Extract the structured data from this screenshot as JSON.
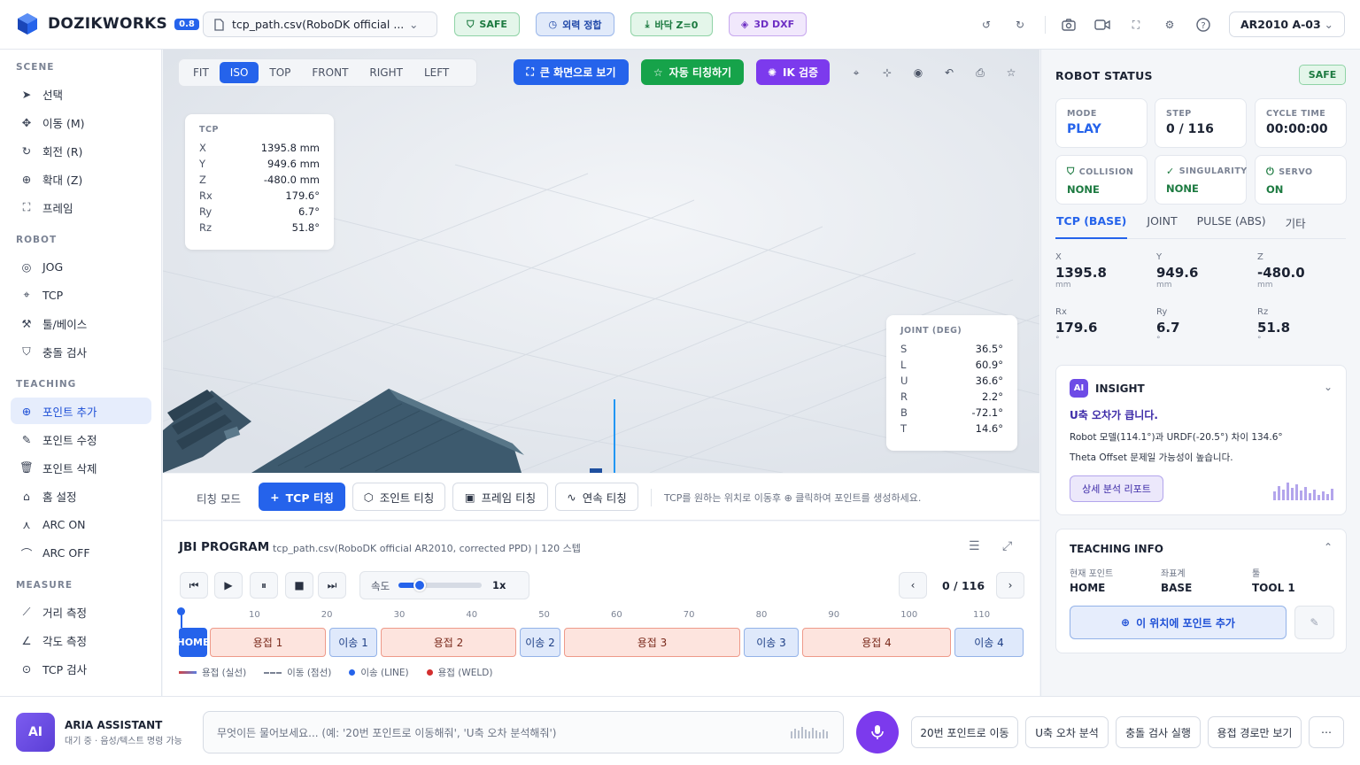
{
  "app": {
    "name": "DOZIKWORKS",
    "version": "0.8"
  },
  "header": {
    "file": "tcp_path.csv(RoboDK official ...",
    "chips": {
      "safe": "SAFE",
      "calib": "외력 정합",
      "floor": "바닥 Z=0",
      "dxf": "3D DXF"
    },
    "robot": "AR2010 A-03"
  },
  "sidebar": {
    "sections": {
      "scene": "SCENE",
      "robot": "ROBOT",
      "teaching": "TEACHING",
      "measure": "MEASURE"
    },
    "scene": [
      "선택",
      "이동 (M)",
      "회전 (R)",
      "확대 (Z)",
      "프레임"
    ],
    "robot": [
      "JOG",
      "TCP",
      "툴/베이스",
      "충돌 검사"
    ],
    "teaching": [
      "포인트 추가",
      "포인트 수정",
      "포인트 삭제",
      "홈 설정",
      "ARC ON",
      "ARC OFF"
    ],
    "measure": [
      "거리 측정",
      "각도 측정",
      "TCP 검사"
    ]
  },
  "viewport": {
    "views": [
      "FIT",
      "ISO",
      "TOP",
      "FRONT",
      "RIGHT",
      "LEFT"
    ],
    "actions": {
      "fullscreen": "큰 화면으로 보기",
      "auto_teach": "자동 티칭하기",
      "ik": "IK 검증"
    },
    "tcp": {
      "title": "TCP",
      "rows": [
        [
          "X",
          "1395.8 mm"
        ],
        [
          "Y",
          "949.6 mm"
        ],
        [
          "Z",
          "-480.0 mm"
        ],
        [
          "Rx",
          "179.6°"
        ],
        [
          "Ry",
          "6.7°"
        ],
        [
          "Rz",
          "51.8°"
        ]
      ]
    },
    "joint": {
      "title": "JOINT (DEG)",
      "rows": [
        [
          "S",
          "36.5°"
        ],
        [
          "L",
          "60.9°"
        ],
        [
          "U",
          "36.6°"
        ],
        [
          "R",
          "2.2°"
        ],
        [
          "B",
          "-72.1°"
        ],
        [
          "T",
          "14.6°"
        ]
      ]
    }
  },
  "teach": {
    "mode_label": "티칭 모드",
    "tcp": "TCP 티칭",
    "joint": "조인트 티칭",
    "frame": "프레임 티칭",
    "cont": "연속 티칭",
    "hint": "TCP를 원하는 위치로 이동후 ⊕ 클릭하여 포인트를 생성하세요."
  },
  "jbi": {
    "title": "JBI PROGRAM",
    "desc": "tcp_path.csv(RoboDK official AR2010, corrected PPD) | 120 스텝",
    "speed_label": "속도",
    "speed_value": "1x",
    "speed_pct": 25,
    "step": "0 / 116",
    "ticks": [
      "10",
      "20",
      "30",
      "40",
      "50",
      "60",
      "70",
      "80",
      "90",
      "100",
      "110"
    ],
    "segments": [
      "HOME",
      "용접 1",
      "이송 1",
      "용접 2",
      "이송 2",
      "용접 3",
      "이송 3",
      "용접 4",
      "이송 4"
    ],
    "legend": [
      "용접 (실선)",
      "이동 (점선)",
      "이송 (LINE)",
      "용접 (WELD)"
    ]
  },
  "status": {
    "title": "ROBOT STATUS",
    "badge": "SAFE",
    "cards": [
      [
        "MODE",
        "PLAY"
      ],
      [
        "STEP",
        "0 / 116"
      ],
      [
        "CYCLE TIME",
        "00:00:00"
      ],
      [
        "COLLISION",
        "NONE"
      ],
      [
        "SINGULARITY",
        "NONE"
      ],
      [
        "SERVO",
        "ON"
      ]
    ],
    "tabs": [
      "TCP (BASE)",
      "JOINT",
      "PULSE (ABS)",
      "기타"
    ],
    "values": [
      [
        "X",
        "1395.8",
        "mm"
      ],
      [
        "Y",
        "949.6",
        "mm"
      ],
      [
        "Z",
        "-480.0",
        "mm"
      ],
      [
        "Rx",
        "179.6",
        "°"
      ],
      [
        "Ry",
        "6.7",
        "°"
      ],
      [
        "Rz",
        "51.8",
        "°"
      ]
    ]
  },
  "insight": {
    "badge": "AI",
    "title": "INSIGHT",
    "headline": "U축 오차가 큽니다.",
    "line1": "Robot 모델(114.1°)과 URDF(-20.5°) 차이 134.6°",
    "line2": "Theta Offset 문제일 가능성이 높습니다.",
    "button": "상세 분석 리포트"
  },
  "teaching_info": {
    "title": "TEACHING INFO",
    "cols": [
      [
        "현재 포인트",
        "HOME"
      ],
      [
        "좌표계",
        "BASE"
      ],
      [
        "툴",
        "TOOL 1"
      ]
    ],
    "add": "이 위치에 포인트 추가"
  },
  "assistant": {
    "badge": "AI",
    "name": "ARIA ASSISTANT",
    "status": "대기 중 · 음성/텍스트 명령 가능",
    "placeholder": "무엇이든 물어보세요... (예: '20번 포인트로 이동해줘', 'U축 오차 분석해줘')",
    "quick": [
      "20번 포인트로 이동",
      "U축 오차 분석",
      "충돌 검사 실행",
      "용접 경로만 보기"
    ]
  }
}
